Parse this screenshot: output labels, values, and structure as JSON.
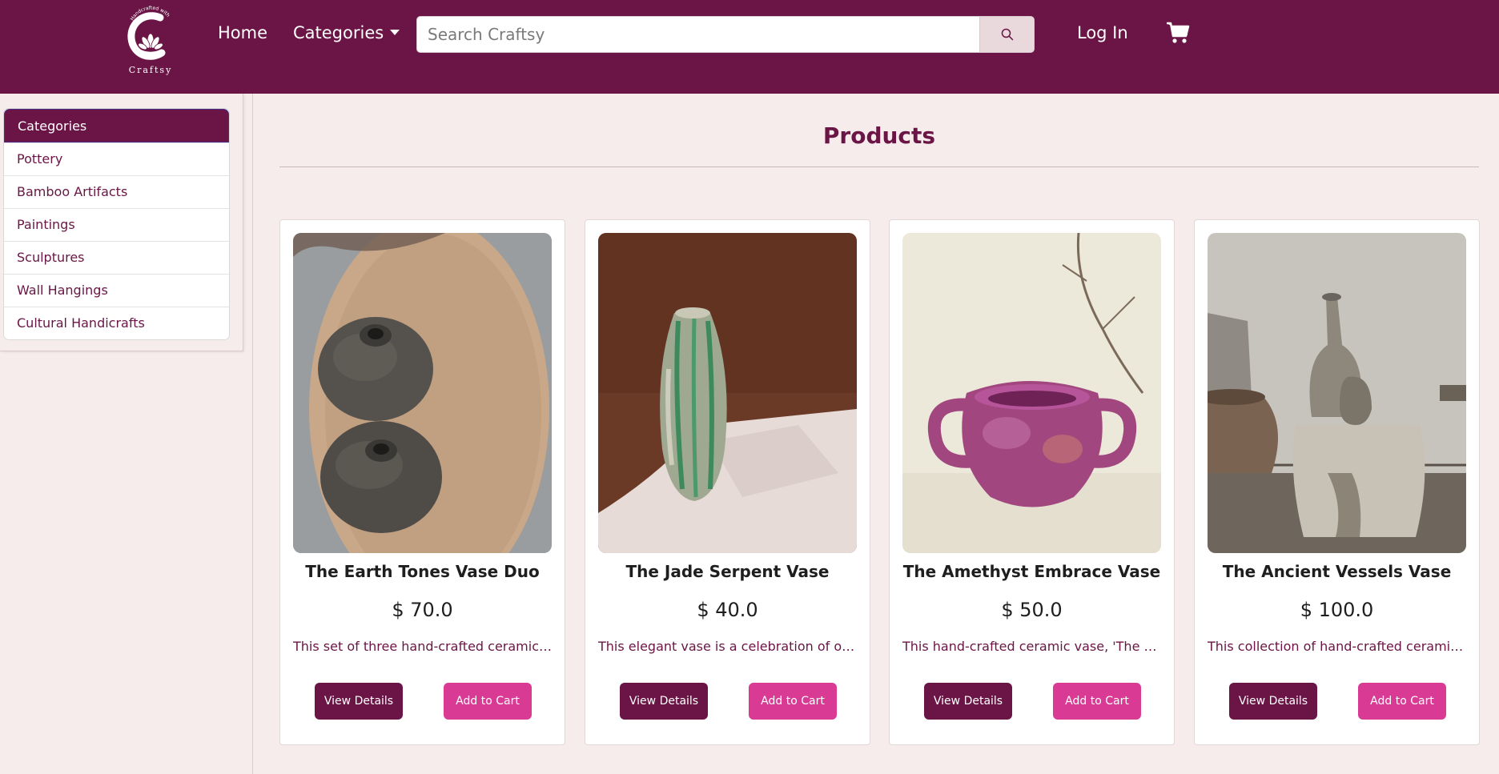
{
  "brand": {
    "name": "Craftsy",
    "tagline": "Handcrafted with Love"
  },
  "nav": {
    "home": "Home",
    "categories": "Categories",
    "login": "Log In"
  },
  "search": {
    "placeholder": "Search Craftsy"
  },
  "sidebar": {
    "header": "Categories",
    "items": [
      {
        "label": "Pottery"
      },
      {
        "label": "Bamboo Artifacts"
      },
      {
        "label": "Paintings"
      },
      {
        "label": "Sculptures"
      },
      {
        "label": "Wall Hangings"
      },
      {
        "label": "Cultural Handicrafts"
      }
    ]
  },
  "main": {
    "title": "Products",
    "products": [
      {
        "name": "The Earth Tones Vase Duo",
        "price": "$ 70.0",
        "description": "This set of three hand-crafted ceramic va...",
        "view_label": "View Details",
        "cart_label": "Add to Cart"
      },
      {
        "name": "The Jade Serpent Vase",
        "price": "$ 40.0",
        "description": "This elegant vase is a celebration of orga...",
        "view_label": "View Details",
        "cart_label": "Add to Cart"
      },
      {
        "name": "The Amethyst Embrace Vase",
        "price": "$ 50.0",
        "description": "This hand-crafted ceramic vase, 'The Am...",
        "view_label": "View Details",
        "cart_label": "Add to Cart"
      },
      {
        "name": "The Ancient Vessels Vase",
        "price": "$ 100.0",
        "description": "This collection of hand-crafted ceramic v...",
        "view_label": "View Details",
        "cart_label": "Add to Cart"
      }
    ]
  },
  "icons": {
    "search": "search-icon",
    "cart": "shopping-cart-icon",
    "caret": "caret-down-icon",
    "logo": "craftsy-logo"
  },
  "colors": {
    "brand": "#6a1545",
    "accent": "#d83a94",
    "background": "#f6ecec"
  }
}
